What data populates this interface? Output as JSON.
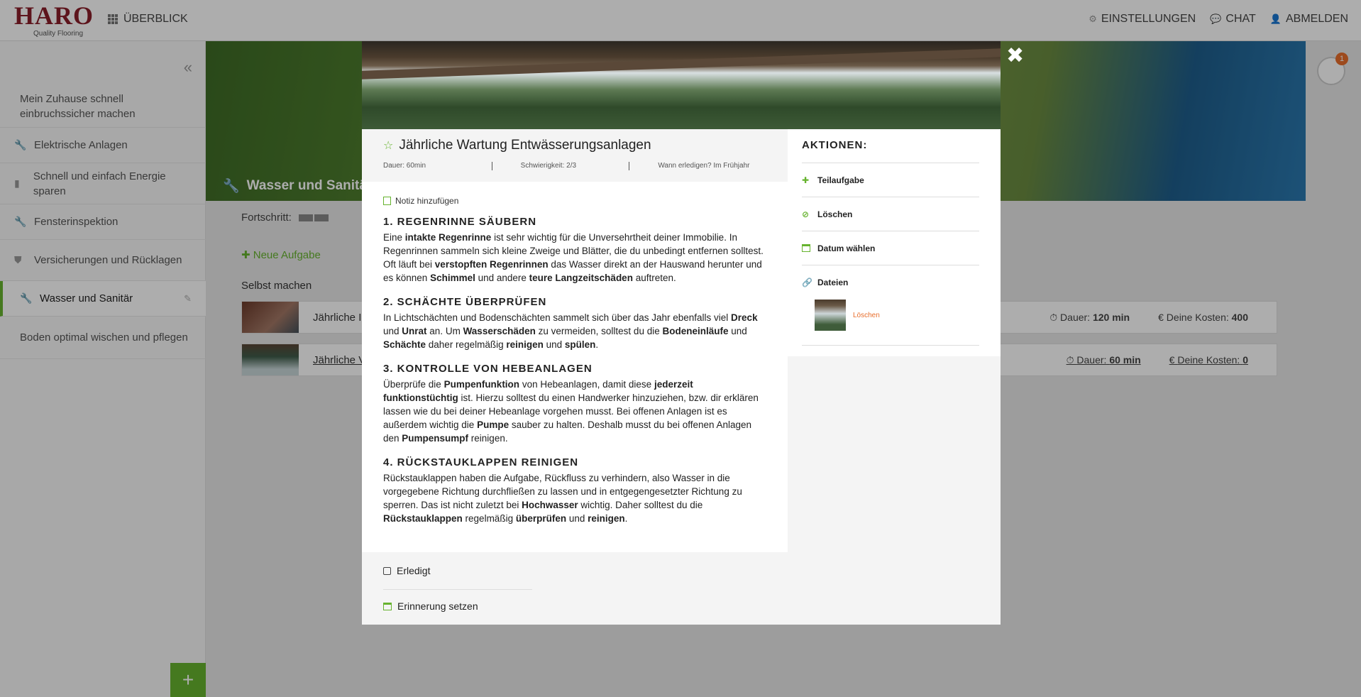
{
  "topbar": {
    "logo_brand": "HARO",
    "logo_tag": "Quality Flooring",
    "overview": "ÜBERBLICK",
    "settings": "EINSTELLUNGEN",
    "chat": "CHAT",
    "logout": "ABMELDEN"
  },
  "sidebar": {
    "items": [
      {
        "label": "Mein Zuhause schnell einbruchssicher machen",
        "icon": ""
      },
      {
        "label": "Elektrische Anlagen",
        "icon": "wrench-icon"
      },
      {
        "label": "Schnell und einfach Energie sparen",
        "icon": "bottle-icon"
      },
      {
        "label": "Fensterinspektion",
        "icon": "wrench-icon"
      },
      {
        "label": "Versicherungen und Rücklagen",
        "icon": "shield-icon"
      },
      {
        "label": "Wasser und Sanitär",
        "icon": "wrench-icon"
      },
      {
        "label": "Boden optimal wischen und pflegen",
        "icon": ""
      }
    ],
    "fab": "+"
  },
  "main": {
    "hero_title": "Wasser und Sanitär",
    "progress_label": "Fortschritt:",
    "new_task": "Neue Aufgabe",
    "section": "Selbst machen",
    "tasks": [
      {
        "name": "Jährliche I",
        "duration_label": "Dauer:",
        "duration": "120 min",
        "cost_label": "Deine Kosten:",
        "cost": "400"
      },
      {
        "name": "Jährliche V",
        "duration_label": "Dauer:",
        "duration": "60 min",
        "cost_label": "Deine Kosten:",
        "cost": "0"
      }
    ],
    "badge": "1"
  },
  "modal": {
    "title": "Jährliche Wartung Entwässerungsanlagen",
    "meta": {
      "duration": "Dauer:   60min",
      "difficulty": "Schwierigkeit:   2/3",
      "when": "Wann erledigen?   Im Frühjahr"
    },
    "note": "Notiz hinzufügen",
    "sections": [
      {
        "heading": "1. REGENRINNE SÄUBERN"
      },
      {
        "heading": "2. SCHÄCHTE ÜBERPRÜFEN"
      },
      {
        "heading": "3. KONTROLLE VON HEBEANLAGEN"
      },
      {
        "heading": "4. RÜCKSTAUKLAPPEN REINIGEN"
      }
    ],
    "done": "Erledigt",
    "reminder": "Erinnerung setzen",
    "actions": {
      "title": "AKTIONEN:",
      "subtask": "Teilaufgabe",
      "delete": "Löschen",
      "date": "Datum wählen",
      "files": "Dateien",
      "file_delete": "Löschen"
    }
  },
  "colors": {
    "accent": "#66b32e",
    "brand": "#8a1e2a",
    "warn": "#e86e2c"
  }
}
